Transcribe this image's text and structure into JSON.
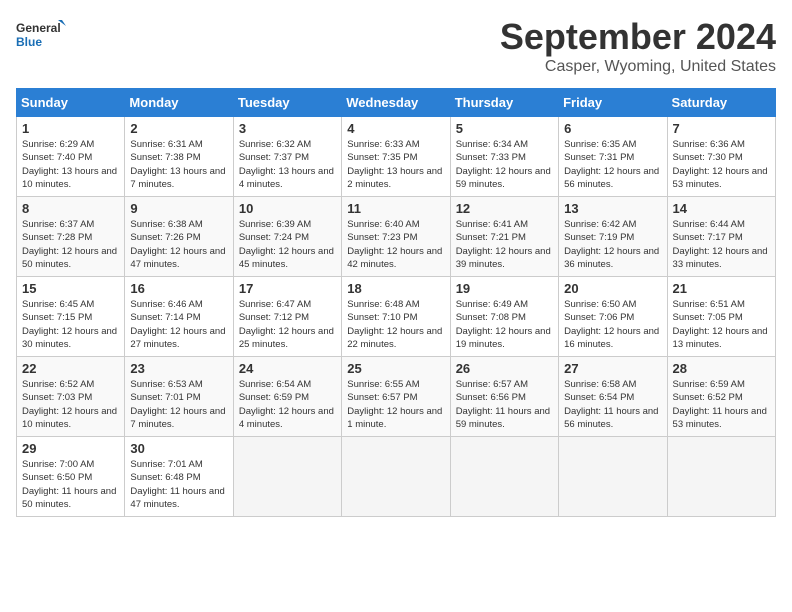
{
  "logo": {
    "line1": "General",
    "line2": "Blue"
  },
  "title": "September 2024",
  "subtitle": "Casper, Wyoming, United States",
  "days_of_week": [
    "Sunday",
    "Monday",
    "Tuesday",
    "Wednesday",
    "Thursday",
    "Friday",
    "Saturday"
  ],
  "weeks": [
    [
      {
        "num": "1",
        "sunrise": "6:29 AM",
        "sunset": "7:40 PM",
        "daylight": "13 hours and 10 minutes."
      },
      {
        "num": "2",
        "sunrise": "6:31 AM",
        "sunset": "7:38 PM",
        "daylight": "13 hours and 7 minutes."
      },
      {
        "num": "3",
        "sunrise": "6:32 AM",
        "sunset": "7:37 PM",
        "daylight": "13 hours and 4 minutes."
      },
      {
        "num": "4",
        "sunrise": "6:33 AM",
        "sunset": "7:35 PM",
        "daylight": "13 hours and 2 minutes."
      },
      {
        "num": "5",
        "sunrise": "6:34 AM",
        "sunset": "7:33 PM",
        "daylight": "12 hours and 59 minutes."
      },
      {
        "num": "6",
        "sunrise": "6:35 AM",
        "sunset": "7:31 PM",
        "daylight": "12 hours and 56 minutes."
      },
      {
        "num": "7",
        "sunrise": "6:36 AM",
        "sunset": "7:30 PM",
        "daylight": "12 hours and 53 minutes."
      }
    ],
    [
      {
        "num": "8",
        "sunrise": "6:37 AM",
        "sunset": "7:28 PM",
        "daylight": "12 hours and 50 minutes."
      },
      {
        "num": "9",
        "sunrise": "6:38 AM",
        "sunset": "7:26 PM",
        "daylight": "12 hours and 47 minutes."
      },
      {
        "num": "10",
        "sunrise": "6:39 AM",
        "sunset": "7:24 PM",
        "daylight": "12 hours and 45 minutes."
      },
      {
        "num": "11",
        "sunrise": "6:40 AM",
        "sunset": "7:23 PM",
        "daylight": "12 hours and 42 minutes."
      },
      {
        "num": "12",
        "sunrise": "6:41 AM",
        "sunset": "7:21 PM",
        "daylight": "12 hours and 39 minutes."
      },
      {
        "num": "13",
        "sunrise": "6:42 AM",
        "sunset": "7:19 PM",
        "daylight": "12 hours and 36 minutes."
      },
      {
        "num": "14",
        "sunrise": "6:44 AM",
        "sunset": "7:17 PM",
        "daylight": "12 hours and 33 minutes."
      }
    ],
    [
      {
        "num": "15",
        "sunrise": "6:45 AM",
        "sunset": "7:15 PM",
        "daylight": "12 hours and 30 minutes."
      },
      {
        "num": "16",
        "sunrise": "6:46 AM",
        "sunset": "7:14 PM",
        "daylight": "12 hours and 27 minutes."
      },
      {
        "num": "17",
        "sunrise": "6:47 AM",
        "sunset": "7:12 PM",
        "daylight": "12 hours and 25 minutes."
      },
      {
        "num": "18",
        "sunrise": "6:48 AM",
        "sunset": "7:10 PM",
        "daylight": "12 hours and 22 minutes."
      },
      {
        "num": "19",
        "sunrise": "6:49 AM",
        "sunset": "7:08 PM",
        "daylight": "12 hours and 19 minutes."
      },
      {
        "num": "20",
        "sunrise": "6:50 AM",
        "sunset": "7:06 PM",
        "daylight": "12 hours and 16 minutes."
      },
      {
        "num": "21",
        "sunrise": "6:51 AM",
        "sunset": "7:05 PM",
        "daylight": "12 hours and 13 minutes."
      }
    ],
    [
      {
        "num": "22",
        "sunrise": "6:52 AM",
        "sunset": "7:03 PM",
        "daylight": "12 hours and 10 minutes."
      },
      {
        "num": "23",
        "sunrise": "6:53 AM",
        "sunset": "7:01 PM",
        "daylight": "12 hours and 7 minutes."
      },
      {
        "num": "24",
        "sunrise": "6:54 AM",
        "sunset": "6:59 PM",
        "daylight": "12 hours and 4 minutes."
      },
      {
        "num": "25",
        "sunrise": "6:55 AM",
        "sunset": "6:57 PM",
        "daylight": "12 hours and 1 minute."
      },
      {
        "num": "26",
        "sunrise": "6:57 AM",
        "sunset": "6:56 PM",
        "daylight": "11 hours and 59 minutes."
      },
      {
        "num": "27",
        "sunrise": "6:58 AM",
        "sunset": "6:54 PM",
        "daylight": "11 hours and 56 minutes."
      },
      {
        "num": "28",
        "sunrise": "6:59 AM",
        "sunset": "6:52 PM",
        "daylight": "11 hours and 53 minutes."
      }
    ],
    [
      {
        "num": "29",
        "sunrise": "7:00 AM",
        "sunset": "6:50 PM",
        "daylight": "11 hours and 50 minutes."
      },
      {
        "num": "30",
        "sunrise": "7:01 AM",
        "sunset": "6:48 PM",
        "daylight": "11 hours and 47 minutes."
      },
      null,
      null,
      null,
      null,
      null
    ]
  ]
}
